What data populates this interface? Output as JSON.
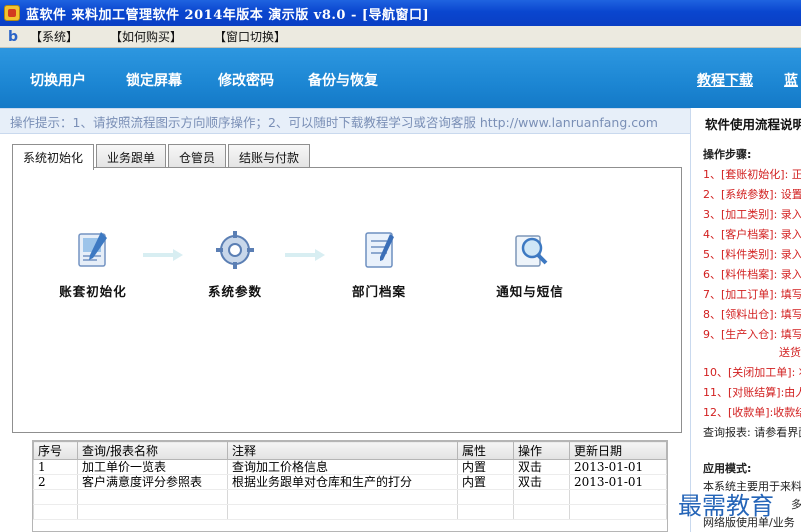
{
  "window": {
    "title": "蓝软件 来料加工管理软件 2014年版本 演示版 v8.0 - [导航窗口]"
  },
  "menubar": {
    "logo": "b",
    "items": [
      "【系统】",
      "【如何购买】",
      "【窗口切换】"
    ]
  },
  "navbar": {
    "items": [
      "切换用户",
      "锁定屏幕",
      "修改密码",
      "备份与恢复"
    ],
    "right_link": "教程下载",
    "right_link_cut": "蓝"
  },
  "hint": {
    "text": "操作提示：1、请按照流程图示方向顺序操作；2、可以随时下载教程学习或咨询客服 http://www.lanruanfang.com"
  },
  "tabs": [
    "系统初始化",
    "业务跟单",
    "仓管员",
    "结账与付款"
  ],
  "flow": {
    "items": [
      {
        "label": "账套初始化",
        "icon": "document-pen-icon"
      },
      {
        "label": "系统参数",
        "icon": "gear-icon"
      },
      {
        "label": "部门档案",
        "icon": "notebook-icon"
      },
      {
        "label": "通知与短信",
        "icon": "magnifier-icon"
      }
    ]
  },
  "report_table": {
    "columns": [
      "序号",
      "查询/报表名称",
      "注释",
      "属性",
      "操作",
      "更新日期"
    ],
    "rows": [
      [
        "1",
        "加工单价一览表",
        "查询加工价格信息",
        "内置",
        "双击",
        "2013-01-01"
      ],
      [
        "2",
        "客户满意度评分参照表",
        "根据业务跟单对仓库和生产的打分",
        "内置",
        "双击",
        "2013-01-01"
      ]
    ]
  },
  "right_panel": {
    "title": "软件使用流程说明",
    "steps_heading": "操作步骤:",
    "steps": [
      "1、[套账初始化]: 正",
      "2、[系统参数]: 设置",
      "3、[加工类别]: 录入",
      "4、[客户档案]: 录入",
      "5、[料件类别]: 录入",
      "6、[料件档案]: 录入",
      "7、[加工订单]: 填写",
      "8、[领料出仓]: 填写",
      "9、[生产入仓]: 填写",
      "送货",
      "10、[关闭加工单]: 将",
      "11、[对账结算]:由人",
      "12、[收款单]:收款结"
    ],
    "query_note": "查询报表: 请参看界面",
    "mode_heading": "应用模式:",
    "mode_line1": "本系统主要用于来料",
    "mode_line2": "多",
    "mode_line3": "网络版使用单/业务"
  },
  "watermark": "最需教育"
}
